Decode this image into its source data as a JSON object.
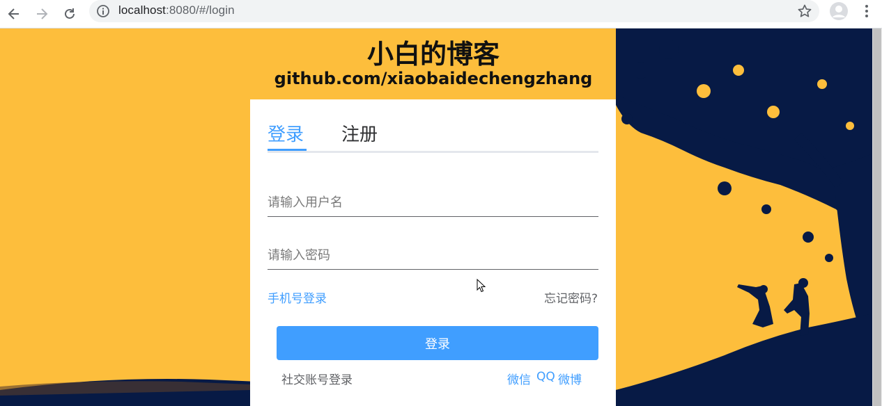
{
  "browser": {
    "url_host": "localhost",
    "url_rest": ":8080/#/login"
  },
  "site": {
    "title": "小白的博客",
    "subtitle": "github.com/xiaobaidechengzhang"
  },
  "login_card": {
    "tabs": [
      {
        "label": "登录",
        "active": true
      },
      {
        "label": "注册",
        "active": false
      }
    ],
    "username_placeholder": "请输入用户名",
    "password_placeholder": "请输入密码",
    "phone_login_label": "手机号登录",
    "forgot_label": "忘记密码?",
    "submit_label": "登录",
    "social_label": "社交账号登录",
    "social_links": [
      "微信",
      "QQ",
      "微博"
    ]
  },
  "colors": {
    "background": "#fdbe3c",
    "silhouette": "#071a45",
    "accent": "#409eff"
  }
}
